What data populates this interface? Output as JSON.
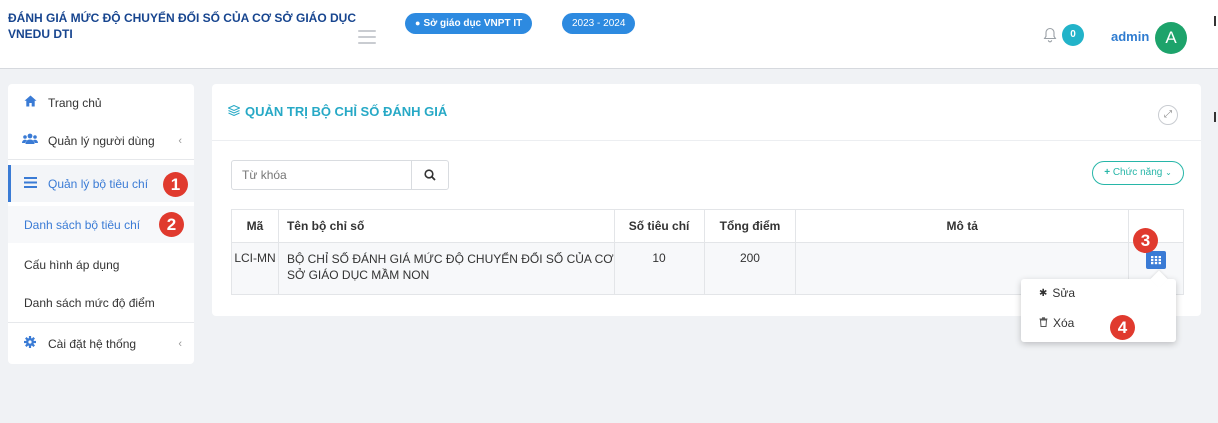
{
  "header": {
    "title_line1": "ĐÁNH GIÁ MỨC ĐỘ CHUYỂN ĐỔI SỐ CỦA CƠ SỞ GIÁO DỤC",
    "title_line2": "VNEDU DTI",
    "org_label": "Sở giáo dục VNPT IT",
    "year_label": "2023 - 2024",
    "notification_count": "0",
    "user_name": "admin",
    "avatar_letter": "A"
  },
  "sidebar": {
    "home": "Trang chủ",
    "users": "Quản lý người dùng",
    "criteria": "Quản lý bộ tiêu chí",
    "criteria_list": "Danh sách bộ tiêu chí",
    "apply_config": "Cấu hình áp dụng",
    "score_levels": "Danh sách mức độ điểm",
    "settings": "Cài đặt hệ thống"
  },
  "annotations": {
    "b1": "1",
    "b2": "2",
    "b3": "3",
    "b4": "4"
  },
  "panel": {
    "title": "QUẢN TRỊ BỘ CHỈ SỐ ĐÁNH GIÁ",
    "search_placeholder": "Từ khóa",
    "function_button": "Chức năng",
    "columns": {
      "code": "Mã",
      "name": "Tên bộ chỉ số",
      "count": "Số tiêu chí",
      "score": "Tổng điểm",
      "desc": "Mô tả"
    },
    "rows": [
      {
        "code": "LCI-MN",
        "name": "BỘ CHỈ SỐ ĐÁNH GIÁ MỨC ĐỘ CHUYỂN ĐỔI SỐ CỦA CƠ SỞ GIÁO DỤC MẦM NON",
        "count": "10",
        "score": "200",
        "desc": ""
      }
    ]
  },
  "menu": {
    "edit": "Sửa",
    "delete": "Xóa"
  },
  "colors": {
    "primary": "#3a7bd5",
    "title_teal": "#27a9c6",
    "badge_red": "#e03a2e",
    "avatar_green": "#1da36b"
  }
}
